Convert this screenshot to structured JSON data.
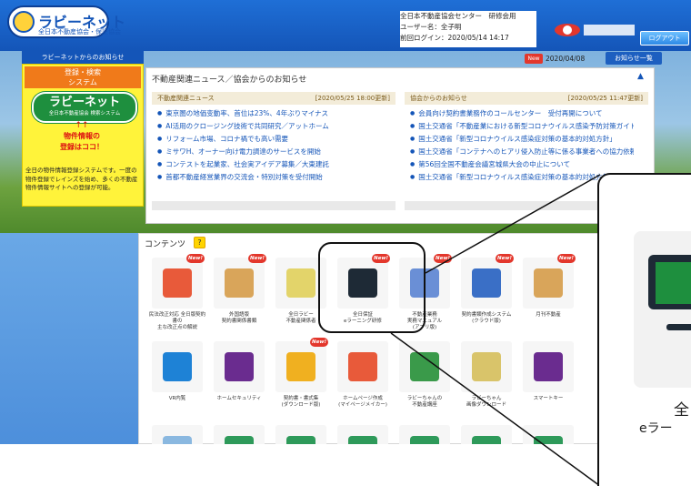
{
  "header": {
    "logo_name": "ラビーネット",
    "logo_sub": "全日本不動産協会・保証協会",
    "org": "全日本不動産協会センター　研修会用",
    "user": "ユーザー名：全子明",
    "last_login": "前回ログイン：2020/05/14 14:17",
    "logout": "ログアウト"
  },
  "left": {
    "tab": "ラビーネットからのお知らせ",
    "system_btn": "登録・検索\nシステム",
    "rabi_title": "ラビーネット",
    "rabi_sub": "全日本不動産協会 検索システム",
    "arrows": "↑↑",
    "bukken1": "物件情報の",
    "bukken2": "登録はココ！",
    "desc": "全日の物件情報登録システムです。一度の物件登録でレインズを始め、多くの不動産物件情報サイトへの登録が可能。"
  },
  "notice": {
    "badge": "New",
    "date": "2020/04/08",
    "all": "お知らせ一覧"
  },
  "news": {
    "title": "不動産関連ニュース／協会からのお知らせ",
    "collapse": "▲",
    "left_head": "不動産関連ニュース",
    "left_time": "[2020/05/25 18:00更新]",
    "left_items": [
      "東京圏の地価变動率、首位は23%、4年ぶりマイナス",
      "AI活用のクロージング技術で共同研究／アットホーム",
      "リフォーム市場、コロナ禍でも高い需要",
      "ミサワH、オーナー向け電力調達のサービスを開始",
      "コンテストを起業家、社会実アイデア募集／大東建託",
      "首都不動産経営業界の交流会・特別対策を受付開始"
    ],
    "right_head": "協会からのお知らせ",
    "right_time": "[2020/05/25 11:47更新]",
    "right_items": [
      "会員向け契約書業務作のコールセンター　受付再開について",
      "国土交通省「不動産業における新型コロナウイルス感染予防対策ガイドライン」",
      "国土交通省「新型コロナウイルス感染症対策の基本的対処方針」",
      "国土交通省「コンテナへのヒアリ侵入防止等に係る事業者への協力依頼」",
      "第56回全国不動産会議宮城県大会の中止について",
      "国土交通省「新型コロナウイルス感染症対策の基本的対処方針」改正"
    ]
  },
  "contents": {
    "label": "コンテンツ",
    "help": "?",
    "new_badge": "New!",
    "tiles": [
      {
        "label": "民法改正対応 全日版契約書の\n主な改正点の解説",
        "icon": "document-icon",
        "color": "#e85a3a",
        "new": true
      },
      {
        "label": "外国語版\n契約書関係書類",
        "icon": "globe-icon",
        "color": "#d9a55a",
        "new": true
      },
      {
        "label": "全日ラビー\n不動産関係者",
        "icon": "rabbit-mascot-icon",
        "color": "#e3d46a",
        "new": false
      },
      {
        "label": "全日保証\neラーニング研修",
        "icon": "monitor-icon",
        "color": "#1e2a36",
        "new": true
      },
      {
        "label": "不動産業務\n実務マニュアル\n(アプリ版)",
        "icon": "rabbit-book-icon",
        "color": "#6a8fd6",
        "new": true
      },
      {
        "label": "契約書類作成システム\n(クラウド版)",
        "icon": "rabbit-doc-icon",
        "color": "#3a6fc6",
        "new": true
      },
      {
        "label": "月刊不動産",
        "icon": "book-icon",
        "color": "#d9a55a",
        "new": true
      },
      {
        "label": "VR内覧",
        "icon": "vr-goggles-icon",
        "color": "#1e82d6",
        "new": false
      },
      {
        "label": "ホームセキュリティ",
        "icon": "shield-icon",
        "color": "#6a2c8f",
        "new": false
      },
      {
        "label": "契約書・書式集\n(ダウンロード版)",
        "icon": "forms-icon",
        "color": "#f0b020",
        "new": true
      },
      {
        "label": "ホームページ作成\n(マイページメイカー)",
        "icon": "laptop-icon",
        "color": "#e85a3a",
        "new": false
      },
      {
        "label": "ラビーちゃんの\n不動産講座",
        "icon": "rabbit-toolbox-icon",
        "color": "#3a9a4a",
        "new": false
      },
      {
        "label": "ラビーちゃん\n画像ダウンロード",
        "icon": "rabbit-pair-icon",
        "color": "#d9c46a",
        "new": false
      },
      {
        "label": "スマートキー",
        "icon": "smart-key-icon",
        "color": "#6a2c8f",
        "new": false
      },
      {
        "label": "",
        "icon": "house-hands-icon",
        "color": "#8ab8e0",
        "new": false
      },
      {
        "label": "",
        "icon": "building-icon",
        "color": "#2e9a5a",
        "new": false
      },
      {
        "label": "",
        "icon": "doc-icon",
        "color": "#2e9a5a",
        "new": false
      },
      {
        "label": "",
        "icon": "network-icon",
        "color": "#2e9a5a",
        "new": false
      },
      {
        "label": "",
        "icon": "frame-icon",
        "color": "#2e9a5a",
        "new": false
      },
      {
        "label": "",
        "icon": "id-card-icon",
        "color": "#2e9a5a",
        "new": false
      },
      {
        "label": "",
        "icon": "download-icon",
        "color": "#2e9a5a",
        "new": false
      }
    ]
  },
  "zoom": {
    "t1": "全",
    "t2": "eラー"
  }
}
